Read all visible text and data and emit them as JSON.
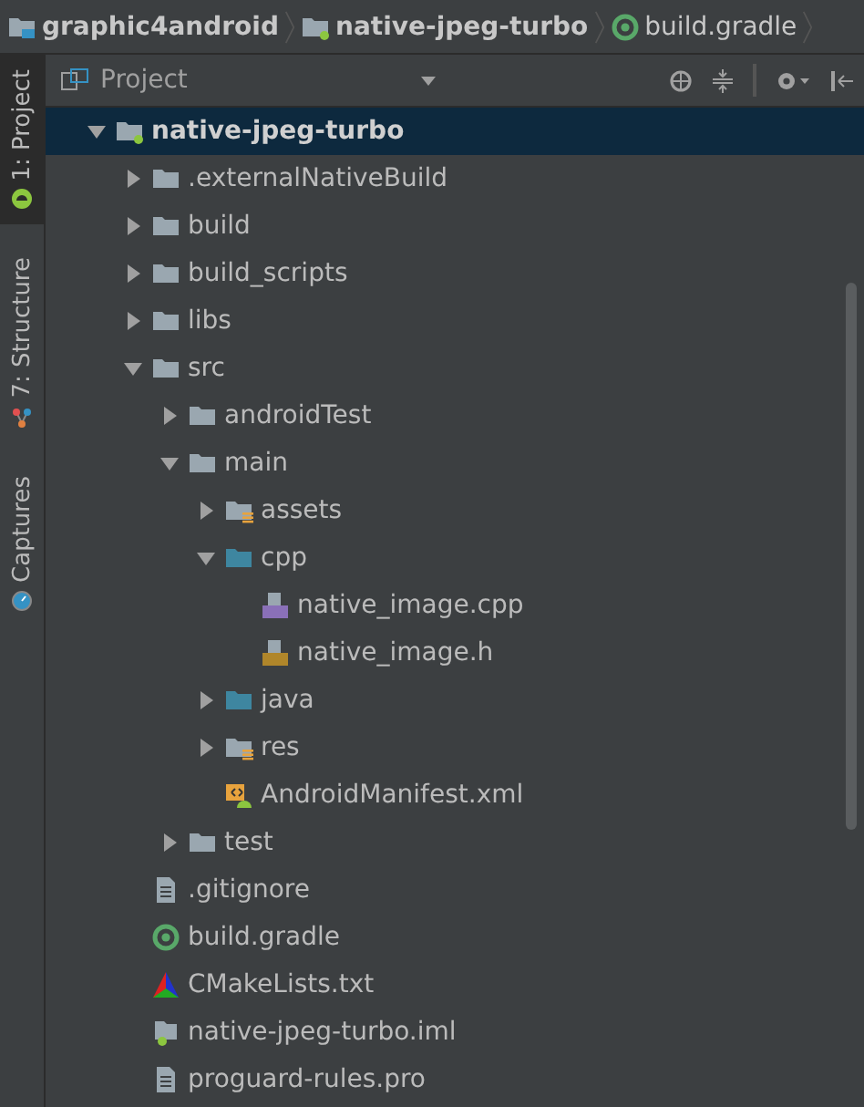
{
  "breadcrumbs": [
    {
      "label": "graphic4android",
      "kind": "project"
    },
    {
      "label": "native-jpeg-turbo",
      "kind": "module"
    },
    {
      "label": "build.gradle",
      "kind": "gradle"
    }
  ],
  "side_tabs": [
    {
      "label": "1: Project",
      "kind": "android",
      "selected": true
    },
    {
      "label": "7: Structure",
      "kind": "structure",
      "selected": false
    },
    {
      "label": "Captures",
      "kind": "captures",
      "selected": false
    }
  ],
  "panel": {
    "title": "Project"
  },
  "tree": [
    {
      "label": "native-jpeg-turbo",
      "kind": "module",
      "expanded": true,
      "selected": true,
      "children": [
        {
          "label": ".externalNativeBuild",
          "kind": "folder",
          "expanded": false,
          "selected": false
        },
        {
          "label": "build",
          "kind": "folder",
          "expanded": false,
          "selected": false
        },
        {
          "label": "build_scripts",
          "kind": "folder",
          "expanded": false,
          "selected": false
        },
        {
          "label": "libs",
          "kind": "folder",
          "expanded": false,
          "selected": false
        },
        {
          "label": "src",
          "kind": "folder",
          "expanded": true,
          "selected": false,
          "children": [
            {
              "label": "androidTest",
              "kind": "folder",
              "expanded": false,
              "selected": false
            },
            {
              "label": "main",
              "kind": "folder",
              "expanded": true,
              "selected": false,
              "children": [
                {
                  "label": "assets",
                  "kind": "resources",
                  "expanded": false,
                  "selected": false
                },
                {
                  "label": "cpp",
                  "kind": "source",
                  "expanded": true,
                  "selected": false,
                  "children": [
                    {
                      "label": "native_image.cpp",
                      "kind": "cpp",
                      "selected": false
                    },
                    {
                      "label": "native_image.h",
                      "kind": "header",
                      "selected": false
                    }
                  ]
                },
                {
                  "label": "java",
                  "kind": "source",
                  "expanded": false,
                  "selected": false
                },
                {
                  "label": "res",
                  "kind": "resources",
                  "expanded": false,
                  "selected": false
                },
                {
                  "label": "AndroidManifest.xml",
                  "kind": "manifest",
                  "selected": false
                }
              ]
            },
            {
              "label": "test",
              "kind": "folder",
              "expanded": false,
              "selected": false
            }
          ]
        },
        {
          "label": ".gitignore",
          "kind": "text",
          "selected": false
        },
        {
          "label": "build.gradle",
          "kind": "gradle",
          "selected": false
        },
        {
          "label": "CMakeLists.txt",
          "kind": "cmake",
          "selected": false
        },
        {
          "label": "native-jpeg-turbo.iml",
          "kind": "module-file",
          "selected": false
        },
        {
          "label": "proguard-rules.pro",
          "kind": "text",
          "selected": false
        }
      ]
    }
  ]
}
